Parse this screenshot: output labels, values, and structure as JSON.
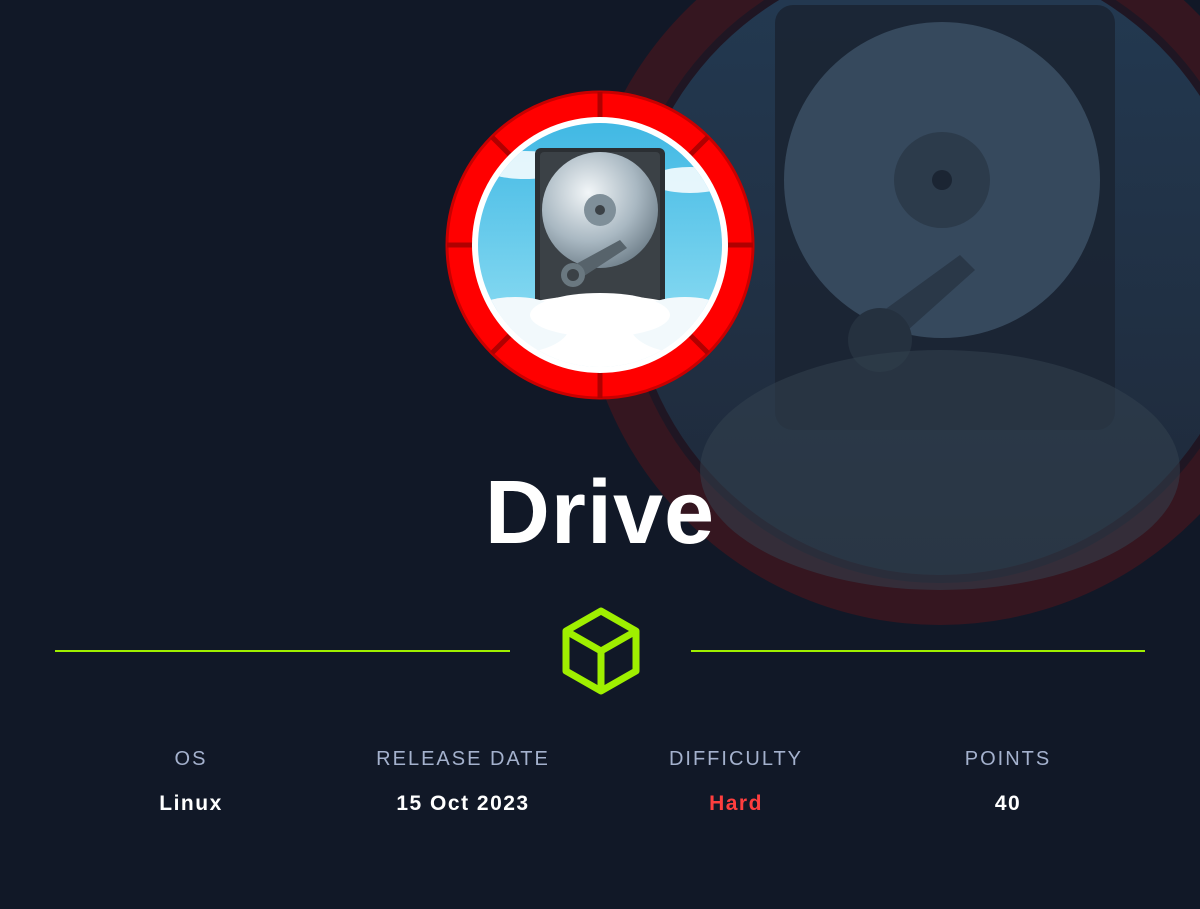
{
  "machine": {
    "name": "Drive"
  },
  "icons": {
    "logo": "hack-the-box-cube-icon",
    "avatar": "hard-drive-cloud-icon"
  },
  "stats": {
    "os": {
      "label": "OS",
      "value": "Linux"
    },
    "release_date": {
      "label": "RELEASE DATE",
      "value": "15 Oct 2023"
    },
    "difficulty": {
      "label": "DIFFICULTY",
      "value": "Hard"
    },
    "points": {
      "label": "POINTS",
      "value": "40"
    }
  },
  "colors": {
    "background": "#111827",
    "accent_green": "#9fef00",
    "ring_red": "#ff0000",
    "difficulty_hard": "#ff3e3e",
    "label_gray": "#a4b1cd"
  }
}
